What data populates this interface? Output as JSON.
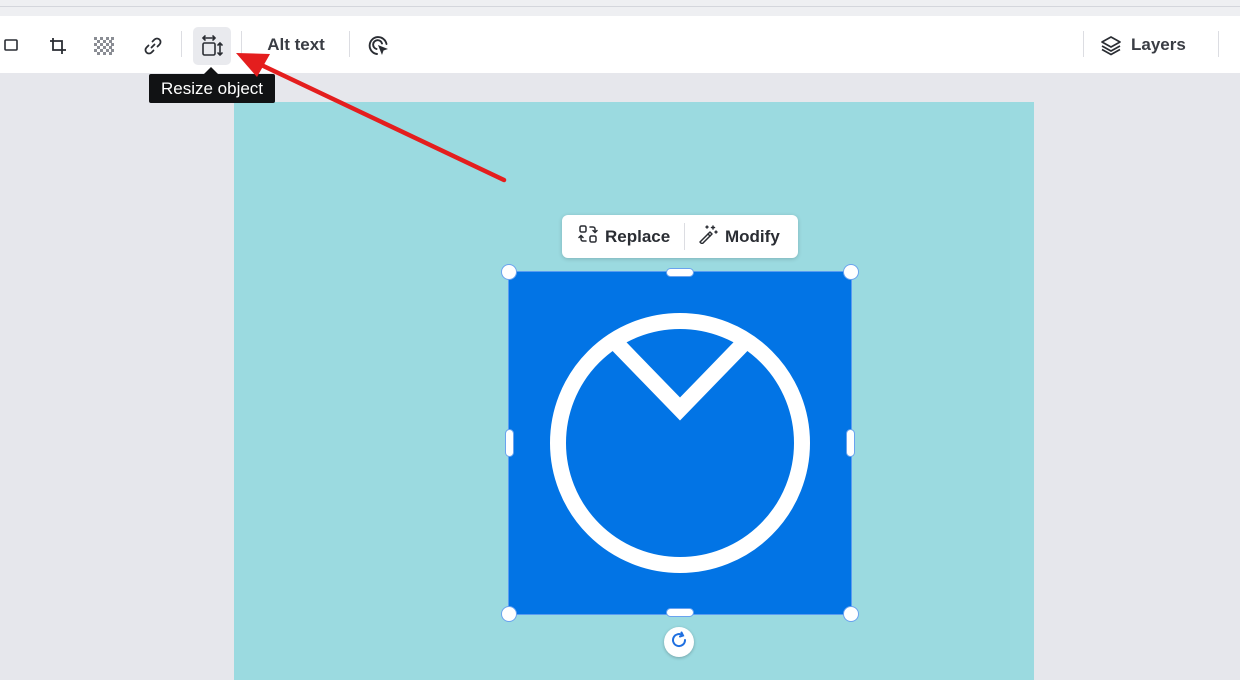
{
  "toolbar": {
    "tools": {
      "position": "position-icon",
      "crop": "crop-icon",
      "transparency": "transparency-icon",
      "link": "link-icon",
      "resize": "resize-object-icon",
      "animate": "animate-icon",
      "layers": "layers-icon"
    },
    "alt_text_label": "Alt text",
    "layers_label": "Layers"
  },
  "tooltip": {
    "text": "Resize object"
  },
  "context_menu": {
    "replace_label": "Replace",
    "modify_label": "Modify"
  },
  "colors": {
    "canvas_background": "#9bdae0",
    "image_background": "#0274e5",
    "selection_accent": "#5a9cf0",
    "annotation_arrow": "#e41e1e"
  }
}
